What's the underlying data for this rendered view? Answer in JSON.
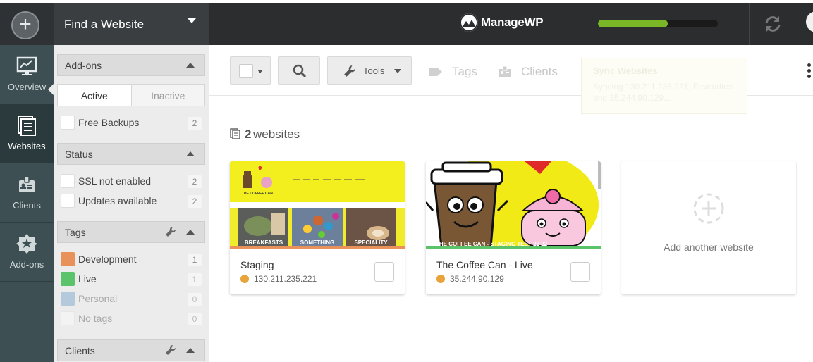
{
  "header": {
    "find_website": "Find a Website",
    "brand": "ManageWP",
    "progress": 0.58
  },
  "leftnav": {
    "items": [
      {
        "label": "Overview",
        "icon": "overview-icon"
      },
      {
        "label": "Websites",
        "icon": "websites-icon",
        "active": true
      },
      {
        "label": "Clients",
        "icon": "clients-icon"
      },
      {
        "label": "Add-ons",
        "icon": "addons-icon"
      }
    ]
  },
  "filters": {
    "addons": {
      "title": "Add-ons",
      "tabs": {
        "active": "Active",
        "inactive": "Inactive"
      },
      "items": [
        {
          "label": "Free Backups",
          "count": "2"
        }
      ]
    },
    "status": {
      "title": "Status",
      "items": [
        {
          "label": "SSL not enabled",
          "count": "2"
        },
        {
          "label": "Updates available",
          "count": "2"
        }
      ]
    },
    "tags": {
      "title": "Tags",
      "items": [
        {
          "label": "Development",
          "count": "1",
          "color": "#e8915a"
        },
        {
          "label": "Live",
          "count": "1",
          "color": "#5bc46b"
        },
        {
          "label": "Personal",
          "count": "0",
          "color": "#b5c9dc"
        },
        {
          "label": "No tags",
          "count": "0"
        }
      ]
    },
    "clients": {
      "title": "Clients"
    }
  },
  "toolbar": {
    "tools": "Tools",
    "tags": "Tags",
    "clients": "Clients",
    "notice_title": "Sync Websites",
    "notice_body": "Syncing 130.211.235.221, Favourites and 35.244.90.129..."
  },
  "main": {
    "count_number": "2",
    "count_label": "websites",
    "sites": [
      {
        "title": "Staging",
        "ip": "130.211.235.221",
        "band_color": "#e8915a"
      },
      {
        "title": "The Coffee Can - Live",
        "ip": "35.244.90.129",
        "band_color": "#5bc46b"
      }
    ],
    "add_another": "Add another website",
    "thumb_labels": [
      "BREAKFASTS",
      "SOMETHING",
      "SPECIALITY"
    ],
    "thumb2_caption": "THE COFFEE CAN - STAGING TEST 22 22",
    "thumb1_logo": "THE COFFEE CAN"
  },
  "colors": {
    "accent_green": "#7ab726",
    "nav_bg": "#3d4f52",
    "topbar_bg": "#2b2d2f"
  }
}
